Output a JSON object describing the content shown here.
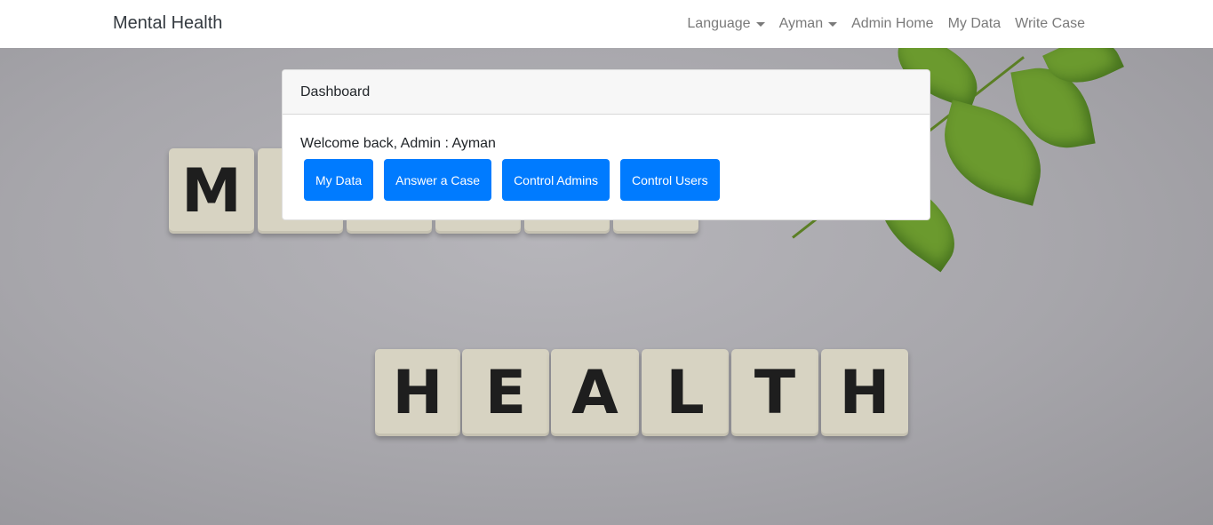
{
  "navbar": {
    "brand": "Mental Health",
    "items": [
      {
        "label": "Language",
        "dropdown": true
      },
      {
        "label": "Ayman",
        "dropdown": true
      },
      {
        "label": "Admin Home",
        "dropdown": false
      },
      {
        "label": "My Data",
        "dropdown": false
      },
      {
        "label": "Write Case",
        "dropdown": false
      }
    ]
  },
  "background": {
    "tiles_top": [
      "M",
      "",
      "",
      "",
      "",
      ""
    ],
    "tiles_bottom": [
      "H",
      "E",
      "A",
      "L",
      "T",
      "H"
    ]
  },
  "dashboard": {
    "header": "Dashboard",
    "welcome": "Welcome back, Admin : Ayman",
    "buttons": [
      "My Data",
      "Answer a Case",
      "Control Admins",
      "Control Users"
    ]
  },
  "colors": {
    "primary": "#007bff",
    "navbar_bg": "#ffffff",
    "nav_text": "#7a7a7a",
    "leaf": "#6b9a2e"
  }
}
